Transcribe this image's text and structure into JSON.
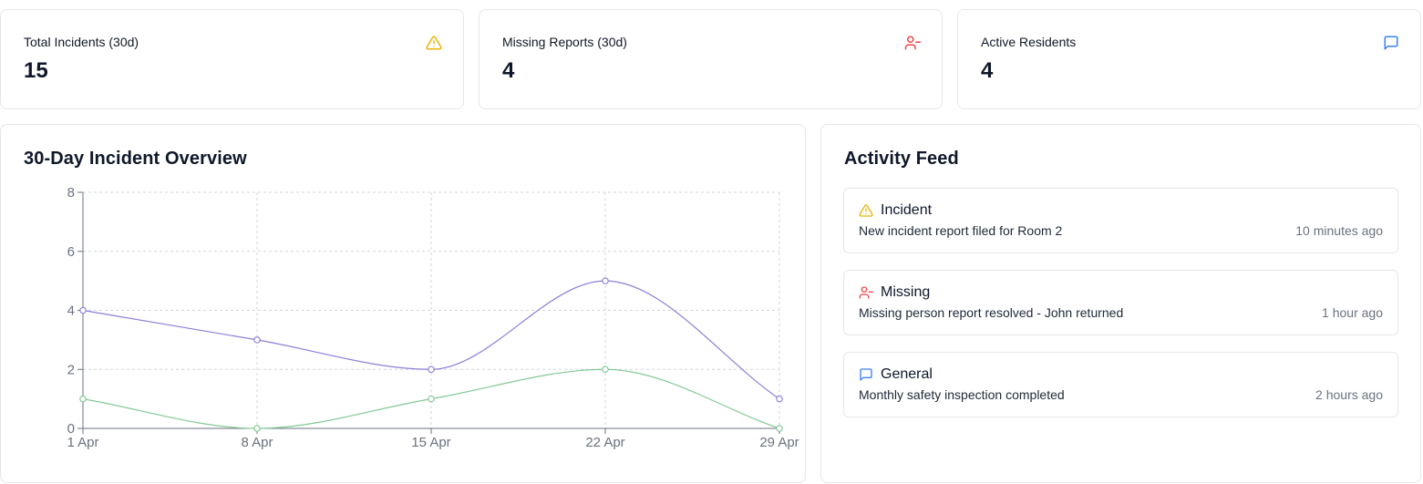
{
  "stats": [
    {
      "label": "Total Incidents (30d)",
      "value": "15",
      "icon": "warning-triangle-icon",
      "color": "#eab308"
    },
    {
      "label": "Missing Reports (30d)",
      "value": "4",
      "icon": "user-minus-icon",
      "color": "#ef4444"
    },
    {
      "label": "Active Residents",
      "value": "4",
      "icon": "message-square-icon",
      "color": "#3b82f6"
    }
  ],
  "chart_panel": {
    "title": "30-Day Incident Overview"
  },
  "chart_data": {
    "type": "line",
    "title": "30-Day Incident Overview",
    "x": [
      "1 Apr",
      "8 Apr",
      "15 Apr",
      "22 Apr",
      "29 Apr"
    ],
    "series": [
      {
        "values": [
          4,
          3,
          2,
          5,
          1
        ],
        "color": "#8b80d8"
      },
      {
        "values": [
          1,
          0,
          1,
          2,
          0
        ],
        "color": "#82c995"
      }
    ],
    "ylim": [
      0,
      8
    ],
    "yticks": [
      0,
      2,
      4,
      6,
      8
    ],
    "grid": true,
    "curve": "smooth"
  },
  "feed": {
    "title": "Activity Feed",
    "items": [
      {
        "title": "Incident",
        "description": "New incident report filed for Room 2",
        "time": "10 minutes ago",
        "icon": "warning-triangle-icon",
        "color": "#eab308"
      },
      {
        "title": "Missing",
        "description": "Missing person report resolved - John returned",
        "time": "1 hour ago",
        "icon": "user-minus-icon",
        "color": "#ef4444"
      },
      {
        "title": "General",
        "description": "Monthly safety inspection completed",
        "time": "2 hours ago",
        "icon": "message-square-icon",
        "color": "#3b82f6"
      }
    ]
  }
}
